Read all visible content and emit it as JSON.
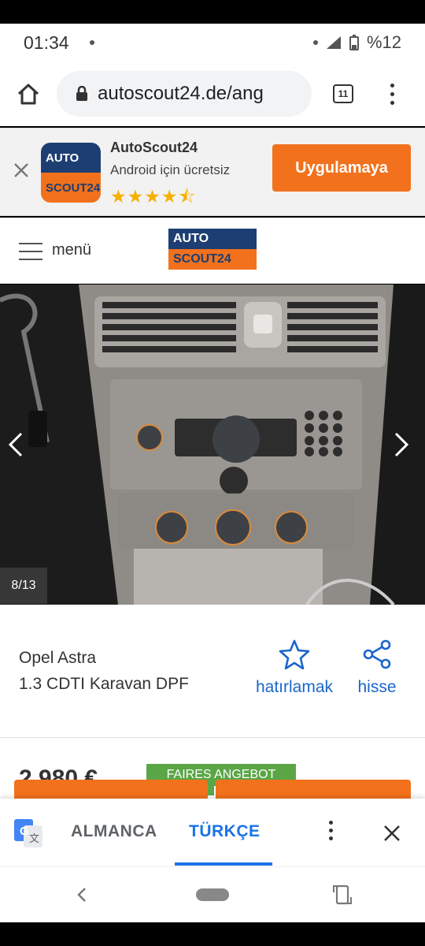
{
  "status_bar": {
    "time": "01:34",
    "battery": "%12"
  },
  "browser": {
    "url": "autoscout24.de/ang",
    "tab_count": "11"
  },
  "app_banner": {
    "logo_top": "AUTO",
    "logo_bottom": "SCOUT24",
    "name": "AutoScout24",
    "subtitle": "Android için ücretsiz",
    "rating": 4.5,
    "stars": "★★★★⯪",
    "install_label": "Uygulamaya"
  },
  "site_header": {
    "menu_label": "menü",
    "logo_top": "AUTO",
    "logo_bottom": "SCOUT24"
  },
  "gallery": {
    "counter": "8/13"
  },
  "listing": {
    "title_line1": "Opel Astra",
    "title_line2": "1.3 CDTI Karavan DPF",
    "remember_label": "hatırlamak",
    "share_label": "hisse",
    "price": "2.980 €",
    "badge": "FAIRES ANGEBOT"
  },
  "translate": {
    "source_lang": "ALMANCA",
    "target_lang": "TÜRKÇE"
  },
  "colors": {
    "brand_orange": "#f2711c",
    "brand_navy": "#1d3e72",
    "link_blue": "#1b66c9",
    "google_blue": "#1a73e8",
    "fair_green": "#5aa646"
  }
}
